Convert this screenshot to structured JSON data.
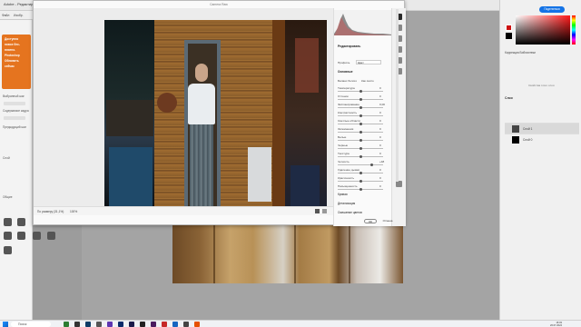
{
  "app": {
    "title": "Adobe - Редактирование",
    "menus": [
      "Файл",
      "Изобр."
    ]
  },
  "left_panel": {
    "card_lines": [
      "Доступно",
      "новое бес-",
      "платно.",
      "Photoshop",
      "Обновить",
      "сейчас"
    ],
    "rows": [
      "Выбранный шаг",
      "Содержимое кадра",
      "Предыдущий шаг",
      "Слой",
      "Общие"
    ]
  },
  "dialog": {
    "title": "Camera Raw",
    "zoom_label": "По размеру (31,1%)",
    "zoom_pct": "100%"
  },
  "settings": {
    "title": "Редактировать",
    "profile_label": "Профиль",
    "profile_value": "Цвет",
    "basic_section": "Основные",
    "white_balance_label": "Баланс белого",
    "white_balance_value": "Как снято",
    "sliders": [
      {
        "label": "Температура",
        "value": "0",
        "pos": 0.5
      },
      {
        "label": "Оттенок",
        "value": "0",
        "pos": 0.5
      },
      {
        "label": "Экспонирование",
        "value": "0,00",
        "pos": 0.5
      },
      {
        "label": "Контрастность",
        "value": "0",
        "pos": 0.5
      },
      {
        "label": "Светлые области",
        "value": "0",
        "pos": 0.5
      },
      {
        "label": "Затемнения",
        "value": "0",
        "pos": 0.5
      },
      {
        "label": "Белые",
        "value": "0",
        "pos": 0.5
      },
      {
        "label": "Черные",
        "value": "0",
        "pos": 0.5
      },
      {
        "label": "Текстура",
        "value": "0",
        "pos": 0.5
      },
      {
        "label": "Четкость",
        "value": "+48",
        "pos": 0.74
      },
      {
        "label": "Удаление дымки",
        "value": "0",
        "pos": 0.5
      },
      {
        "label": "Красочность",
        "value": "0",
        "pos": 0.5
      },
      {
        "label": "Насыщенность",
        "value": "0",
        "pos": 0.5
      }
    ],
    "sections": [
      "Кривая",
      "Детализация",
      "Смешение цветов"
    ],
    "ok": "ОК",
    "cancel": "Отмена"
  },
  "right_panel": {
    "share": "Поделиться",
    "tabs": "Коррекция  Библиотеки",
    "adjust_hint": "Свойства этого слоя",
    "layers_tab": "Слои",
    "layers": [
      {
        "name": "Слой 1",
        "selected": true
      },
      {
        "name": "Слой 0",
        "selected": false
      }
    ],
    "color_fg": "#cc1111",
    "color_bg": "#000000"
  },
  "taskbar": {
    "search": "Поиск",
    "time": "16:03",
    "date": "26.07.2024"
  }
}
